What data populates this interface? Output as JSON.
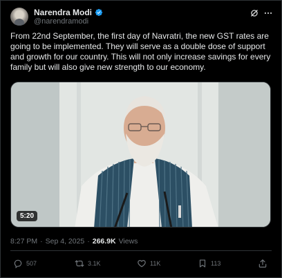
{
  "post": {
    "author_name": "Narendra Modi",
    "author_handle": "@narendramodi",
    "text": "From 22nd September, the first day of Navratri, the new GST rates are going to be implemented. They will serve as a double dose of support and growth for our country. This will not only increase savings for every family but will also give new strength to our economy.",
    "video_duration": "5:20",
    "time": "8:27 PM",
    "separator": "·",
    "date": "Sep 4, 2025",
    "views_count": "266.9K",
    "views_label": "Views"
  },
  "actions": {
    "replies": "507",
    "reposts": "3.1K",
    "likes": "11K",
    "bookmarks": "113"
  },
  "colors": {
    "background": "#000000",
    "text": "#e7e9ea",
    "muted": "#71767b",
    "verified": "#1d9bf0",
    "border": "#2f3336"
  },
  "icons": [
    "verified-badge-icon",
    "grok-icon",
    "more-icon",
    "reply-icon",
    "repost-icon",
    "like-icon",
    "bookmark-icon",
    "share-icon"
  ]
}
